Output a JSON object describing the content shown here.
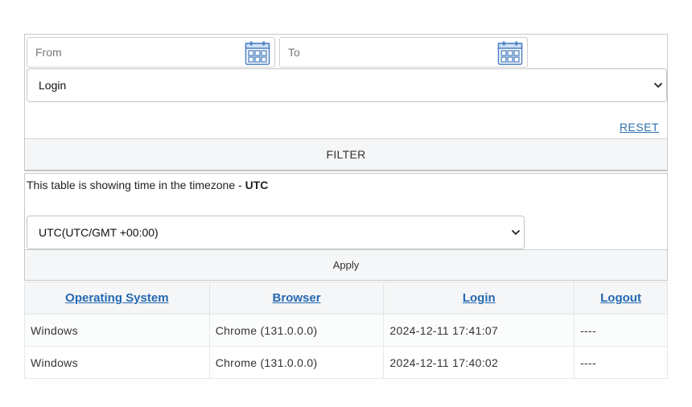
{
  "filters": {
    "from_placeholder": "From",
    "to_placeholder": "To",
    "calendar_icon": "calendar-icon",
    "event_type": "Login",
    "reset_label": "RESET",
    "filter_label": "FILTER"
  },
  "timezone": {
    "note_prefix": "This table is showing time in the timezone - ",
    "current": "UTC",
    "selected": "UTC(UTC/GMT +00:00)",
    "apply_label": "Apply"
  },
  "table": {
    "headers": [
      "Operating System",
      "Browser",
      "Login",
      "Logout"
    ],
    "rows": [
      [
        "Windows",
        "Chrome (131.0.0.0)",
        "2024-12-11 17:41:07",
        "----"
      ],
      [
        "Windows",
        "Chrome (131.0.0.0)",
        "2024-12-11 17:40:02",
        "----"
      ]
    ]
  },
  "colors": {
    "link": "#2468b0",
    "calendar_icon": "#4a7fc1",
    "button_bg": "#f4f6f7"
  }
}
